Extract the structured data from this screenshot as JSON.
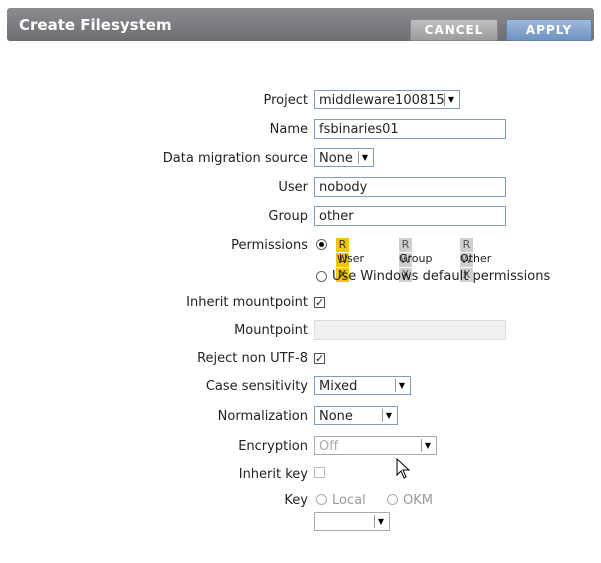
{
  "header": {
    "title": "Create Filesystem",
    "cancel_label": "CANCEL",
    "apply_label": "APPLY"
  },
  "form": {
    "project_label": "Project",
    "project_value": "middleware100815",
    "name_label": "Name",
    "name_value": "fsbinaries01",
    "migration_label": "Data migration source",
    "migration_value": "None",
    "user_label": "User",
    "user_value": "nobody",
    "group_label": "Group",
    "group_value": "other",
    "permissions_label": "Permissions",
    "perm_user": [
      "R",
      "W",
      "X"
    ],
    "perm_group": [
      "R",
      "W",
      "X"
    ],
    "perm_other": [
      "R",
      "W",
      "X"
    ],
    "perm_user_caption": "User",
    "perm_group_caption": "Group",
    "perm_other_caption": "Other",
    "windows_perm_label": "Use Windows default permissions",
    "inherit_mount_label": "Inherit mountpoint",
    "inherit_mount_checked": true,
    "mountpoint_label": "Mountpoint",
    "mountpoint_value": "",
    "reject_utf8_label": "Reject non UTF-8",
    "reject_utf8_checked": true,
    "case_label": "Case sensitivity",
    "case_value": "Mixed",
    "normalization_label": "Normalization",
    "normalization_value": "None",
    "encryption_label": "Encryption",
    "encryption_value": "Off",
    "inherit_key_label": "Inherit key",
    "inherit_key_checked": false,
    "key_label": "Key",
    "key_local": "Local",
    "key_okm": "OKM",
    "key_select_value": ""
  }
}
